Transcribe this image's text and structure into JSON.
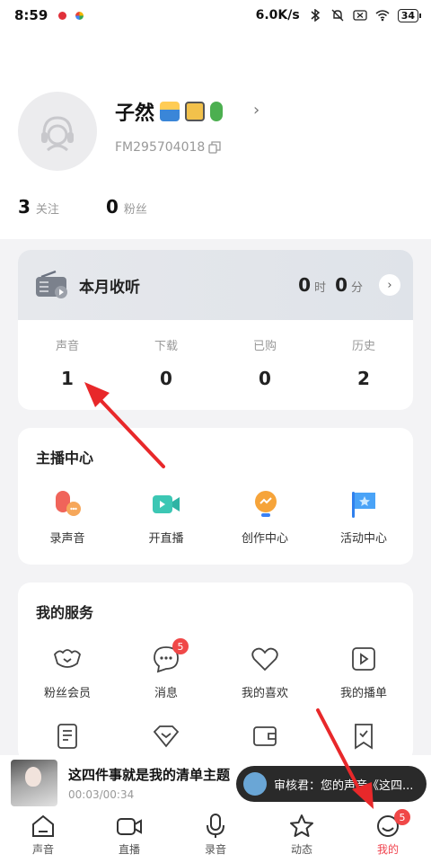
{
  "status_bar": {
    "time": "8:59",
    "network_speed": "6.0K/s",
    "battery": "34"
  },
  "profile": {
    "username": "子然",
    "fm_id": "FM295704018",
    "following_count": "3",
    "following_label": "关注",
    "fans_count": "0",
    "fans_label": "粉丝"
  },
  "listen": {
    "title": "本月收听",
    "hours": "0",
    "hours_unit": "时",
    "minutes": "0",
    "minutes_unit": "分",
    "stats": [
      {
        "label": "声音",
        "value": "1"
      },
      {
        "label": "下载",
        "value": "0"
      },
      {
        "label": "已购",
        "value": "0"
      },
      {
        "label": "历史",
        "value": "2"
      }
    ]
  },
  "anchor_center": {
    "title": "主播中心",
    "items": [
      {
        "label": "录声音",
        "icon": "record-voice-icon"
      },
      {
        "label": "开直播",
        "icon": "live-icon"
      },
      {
        "label": "创作中心",
        "icon": "creation-icon"
      },
      {
        "label": "活动中心",
        "icon": "activity-icon"
      }
    ]
  },
  "services": {
    "title": "我的服务",
    "items": [
      {
        "label": "粉丝会员",
        "icon": "fan-member-icon"
      },
      {
        "label": "消息",
        "icon": "message-icon",
        "badge": "5"
      },
      {
        "label": "我的喜欢",
        "icon": "heart-icon"
      },
      {
        "label": "我的播单",
        "icon": "playlist-icon"
      }
    ]
  },
  "player": {
    "title": "这四件事就是我的清单主题",
    "time": "00:03/00:34"
  },
  "toast": {
    "text": "审核君：您的声音《这四..."
  },
  "tabbar": {
    "tabs": [
      {
        "label": "声音",
        "icon": "home-icon"
      },
      {
        "label": "直播",
        "icon": "video-icon"
      },
      {
        "label": "录音",
        "icon": "mic-icon"
      },
      {
        "label": "动态",
        "icon": "star-icon"
      },
      {
        "label": "我的",
        "icon": "profile-icon",
        "badge": "5",
        "active": true
      }
    ]
  },
  "colors": {
    "accent": "#f0434e",
    "badge": "#f04848",
    "annotation_arrow": "#e8282a"
  }
}
